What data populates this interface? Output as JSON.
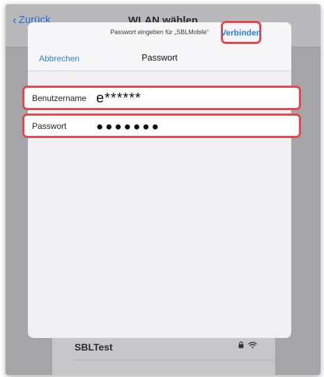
{
  "background": {
    "back_label": "Zurück",
    "title": "WLAN wählen",
    "network_row": "SBLTest",
    "lock_icon": "lock-icon",
    "wifi_icon": "wifi-icon"
  },
  "dialog": {
    "prompt": "Passwort eingeben für „SBLMobile“",
    "cancel_label": "Abbrechen",
    "title": "Passwort",
    "connect_label": "Verbinden"
  },
  "fields": {
    "username": {
      "label": "Benutzername",
      "value": "e******"
    },
    "password": {
      "label": "Passwort",
      "value": "●●●●●●●"
    }
  },
  "colors": {
    "accent": "#2b7fe0",
    "highlight": "#e8444b"
  }
}
